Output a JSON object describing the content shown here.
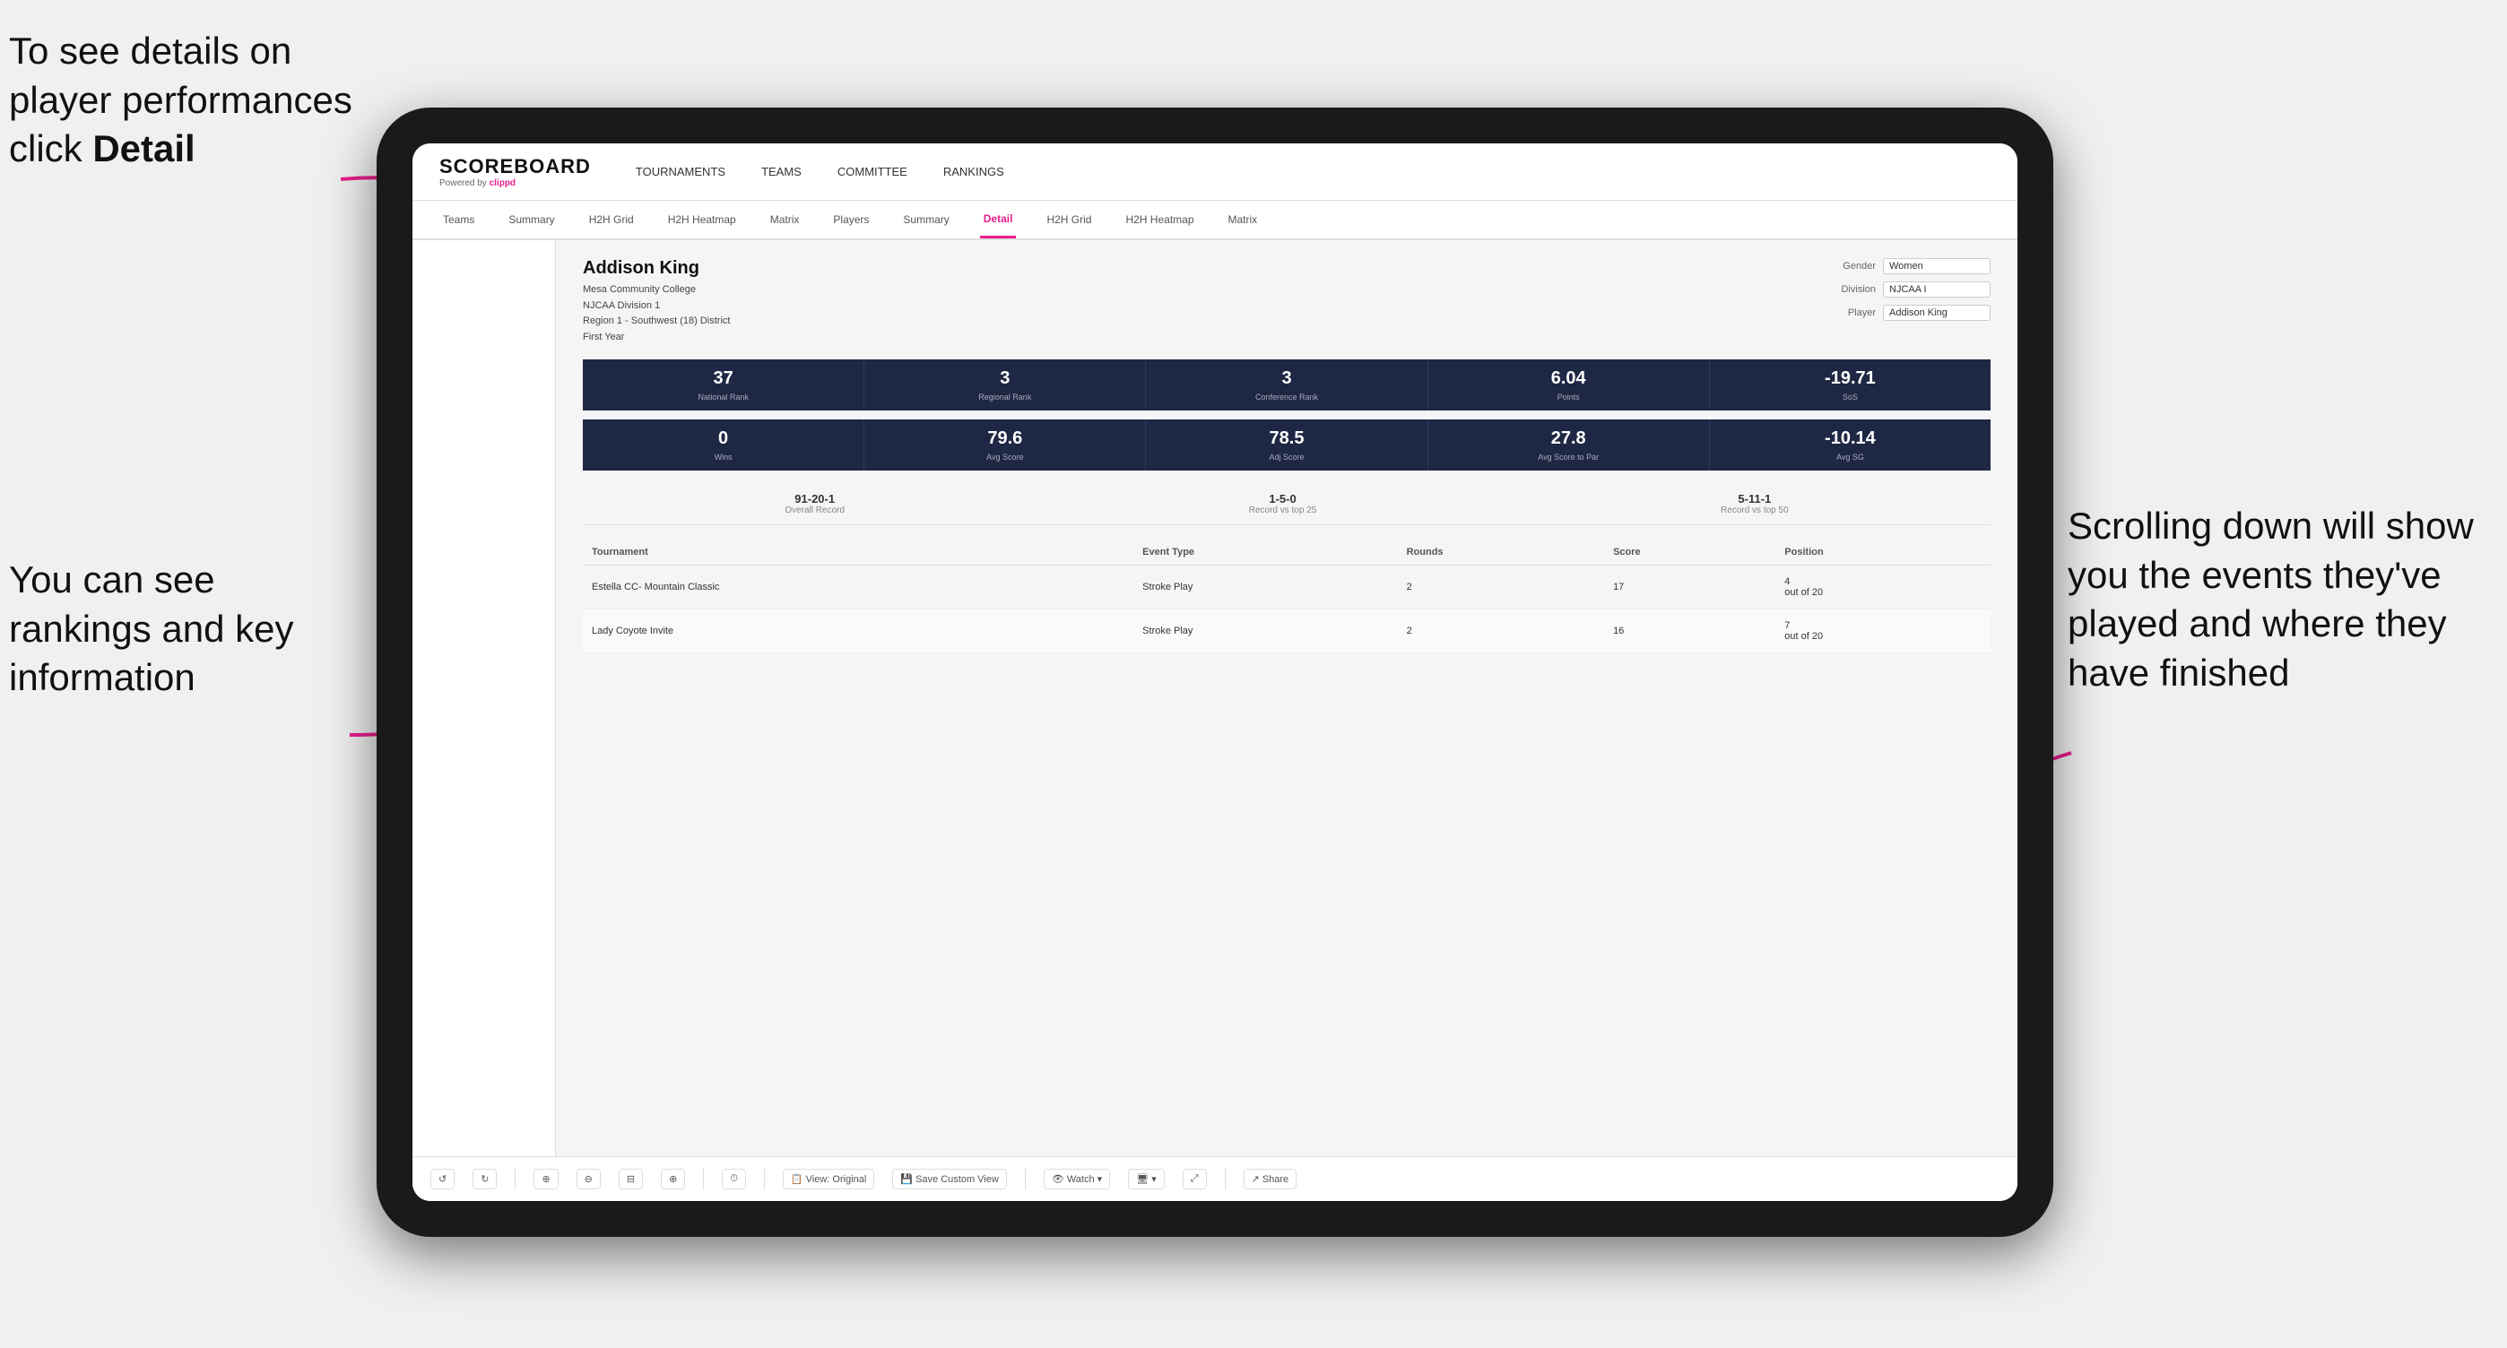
{
  "annotations": {
    "top_left": "To see details on player performances click Detail",
    "bottom_left": "You can see rankings and key information",
    "right": "Scrolling down will show you the events they've played and where they have finished"
  },
  "nav": {
    "logo": "SCOREBOARD",
    "logo_sub": "Powered by clippd",
    "items": [
      "TOURNAMENTS",
      "TEAMS",
      "COMMITTEE",
      "RANKINGS"
    ]
  },
  "sub_nav": {
    "items": [
      "Teams",
      "Summary",
      "H2H Grid",
      "H2H Heatmap",
      "Matrix",
      "Players",
      "Summary",
      "Detail",
      "H2H Grid",
      "H2H Heatmap",
      "Matrix"
    ],
    "active": "Detail"
  },
  "player": {
    "name": "Addison King",
    "college": "Mesa Community College",
    "division": "NJCAA Division 1",
    "region": "Region 1 - Southwest (18) District",
    "year": "First Year"
  },
  "controls": {
    "gender_label": "Gender",
    "gender_value": "Women",
    "division_label": "Division",
    "division_value": "NJCAA I",
    "player_label": "Player",
    "player_value": "Addison King"
  },
  "stats_row1": [
    {
      "value": "37",
      "label": "National Rank"
    },
    {
      "value": "3",
      "label": "Regional Rank"
    },
    {
      "value": "3",
      "label": "Conference Rank"
    },
    {
      "value": "6.04",
      "label": "Points"
    },
    {
      "value": "-19.71",
      "label": "SoS"
    }
  ],
  "stats_row2": [
    {
      "value": "0",
      "label": "Wins"
    },
    {
      "value": "79.6",
      "label": "Avg Score"
    },
    {
      "value": "78.5",
      "label": "Adj Score"
    },
    {
      "value": "27.8",
      "label": "Avg Score to Par"
    },
    {
      "value": "-10.14",
      "label": "Avg SG"
    }
  ],
  "records": [
    {
      "value": "91-20-1",
      "label": "Overall Record"
    },
    {
      "value": "1-5-0",
      "label": "Record vs top 25"
    },
    {
      "value": "5-11-1",
      "label": "Record vs top 50"
    }
  ],
  "table": {
    "headers": [
      "Tournament",
      "Event Type",
      "Rounds",
      "Score",
      "Position"
    ],
    "rows": [
      {
        "tournament": "Estella CC- Mountain Classic",
        "event_type": "Stroke Play",
        "rounds": "2",
        "score": "17",
        "position": "4 out of 20"
      },
      {
        "tournament": "Lady Coyote Invite",
        "event_type": "Stroke Play",
        "rounds": "2",
        "score": "16",
        "position": "7 out of 20"
      }
    ]
  },
  "toolbar": {
    "buttons": [
      "↺",
      "↻",
      "⊕",
      "⊖",
      "⊟",
      "⊕",
      "⏱",
      "View: Original",
      "Save Custom View",
      "Watch ▾",
      "🖥 ▾",
      "⤢",
      "Share"
    ]
  }
}
